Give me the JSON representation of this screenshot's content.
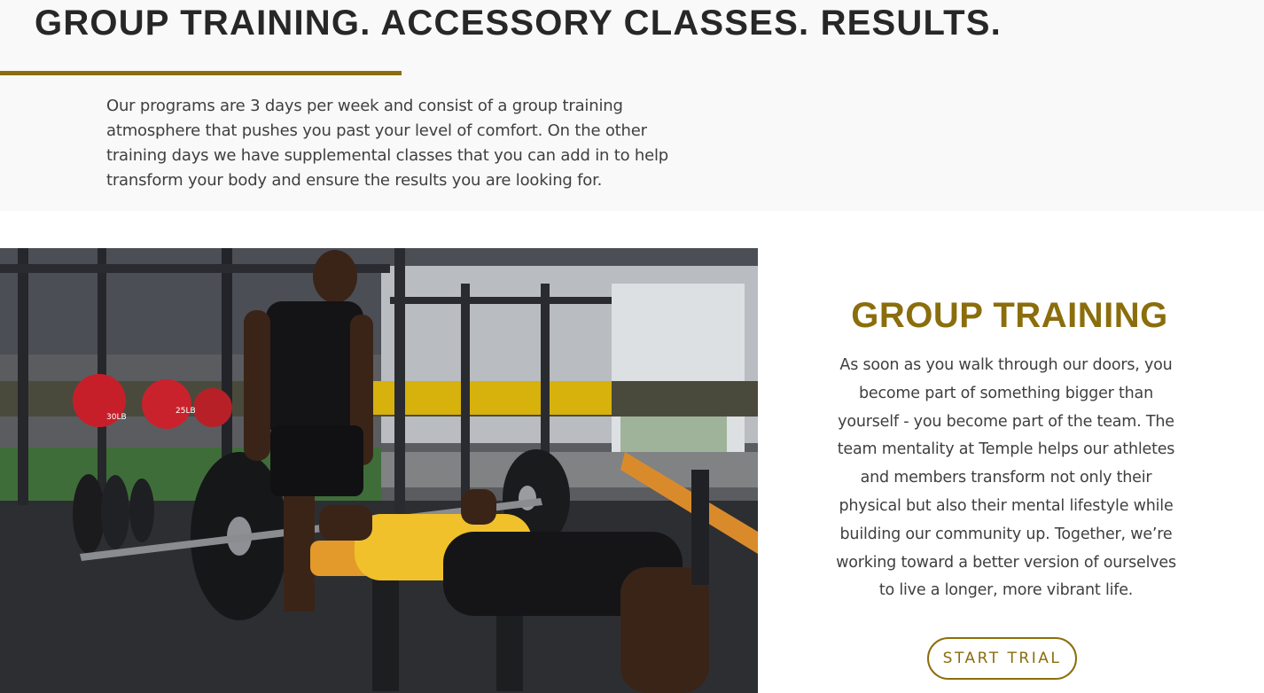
{
  "hero": {
    "headline": "GROUP TRAINING. ACCESSORY CLASSES. RESULTS.",
    "intro": "Our programs are 3 days per week and consist of a group training atmosphere that pushes you past your level of comfort. On the other training days we have supplemental classes that you can add in to help transform your body and ensure the results you are looking for."
  },
  "feature": {
    "title": "GROUP TRAINING",
    "body": "As soon as you walk through our doors, you become part of something bigger than yourself - you become part of the team. The team mentality at Temple helps our athletes and members transform not only their physical but also their mental lifestyle while building our community up. Together, we’re working toward a better version of ourselves to live a longer, more vibrant life.",
    "cta_label": "START TRIAL",
    "photo_plate_labels": [
      "30LB",
      "25LB"
    ]
  },
  "colors": {
    "accent_gold": "#8b6e0c",
    "text_dark": "#272727",
    "text_body": "#3f3f3f",
    "band_bg": "#f9f9f9"
  }
}
